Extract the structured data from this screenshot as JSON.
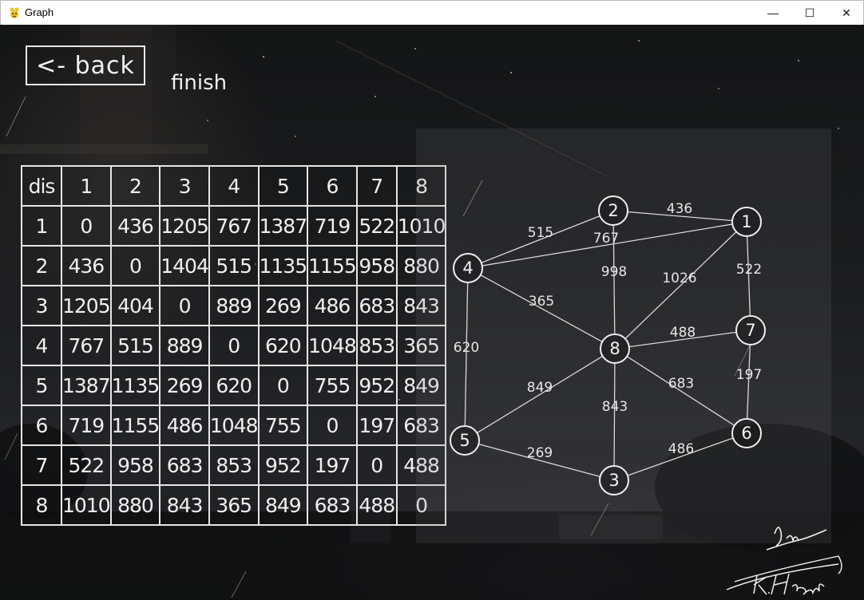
{
  "window": {
    "title": "Graph",
    "minimize_glyph": "—",
    "maximize_glyph": "☐",
    "close_glyph": "✕"
  },
  "controls": {
    "back_label": "<- back",
    "status": "finish"
  },
  "table": {
    "header": [
      "dis",
      "1",
      "2",
      "3",
      "4",
      "5",
      "6",
      "7",
      "8"
    ],
    "rows": [
      [
        "1",
        "0",
        "436",
        "1205",
        "767",
        "1387",
        "719",
        "522",
        "1010"
      ],
      [
        "2",
        "436",
        "0",
        "1404",
        "515",
        "1135",
        "1155",
        "958",
        "880"
      ],
      [
        "3",
        "1205",
        "404",
        "0",
        "889",
        "269",
        "486",
        "683",
        "843"
      ],
      [
        "4",
        "767",
        "515",
        "889",
        "0",
        "620",
        "1048",
        "853",
        "365"
      ],
      [
        "5",
        "1387",
        "1135",
        "269",
        "620",
        "0",
        "755",
        "952",
        "849"
      ],
      [
        "6",
        "719",
        "1155",
        "486",
        "1048",
        "755",
        "0",
        "197",
        "683"
      ],
      [
        "7",
        "522",
        "958",
        "683",
        "853",
        "952",
        "197",
        "0",
        "488"
      ],
      [
        "8",
        "1010",
        "880",
        "843",
        "365",
        "849",
        "683",
        "488",
        "0"
      ]
    ]
  },
  "graph": {
    "nodes": [
      "1",
      "2",
      "3",
      "4",
      "5",
      "6",
      "7",
      "8"
    ],
    "edges": [
      {
        "from": "2",
        "to": "1",
        "weight": "436"
      },
      {
        "from": "4",
        "to": "2",
        "weight": "515"
      },
      {
        "from": "4",
        "to": "1",
        "weight": "767"
      },
      {
        "from": "2",
        "to": "8",
        "weight": "998"
      },
      {
        "from": "8",
        "to": "1",
        "weight": "1026"
      },
      {
        "from": "1",
        "to": "7",
        "weight": "522"
      },
      {
        "from": "4",
        "to": "8",
        "weight": "365"
      },
      {
        "from": "4",
        "to": "5",
        "weight": "620"
      },
      {
        "from": "8",
        "to": "7",
        "weight": "488"
      },
      {
        "from": "7",
        "to": "6",
        "weight": "197"
      },
      {
        "from": "5",
        "to": "8",
        "weight": "849"
      },
      {
        "from": "8",
        "to": "6",
        "weight": "683"
      },
      {
        "from": "8",
        "to": "3",
        "weight": "843"
      },
      {
        "from": "5",
        "to": "3",
        "weight": "269"
      },
      {
        "from": "3",
        "to": "6",
        "weight": "486"
      }
    ]
  },
  "signature": "K. Hanada",
  "colors": {
    "line": "#d8d8d8",
    "text": "#f0f0f0",
    "panel": "#2a2b2e"
  }
}
